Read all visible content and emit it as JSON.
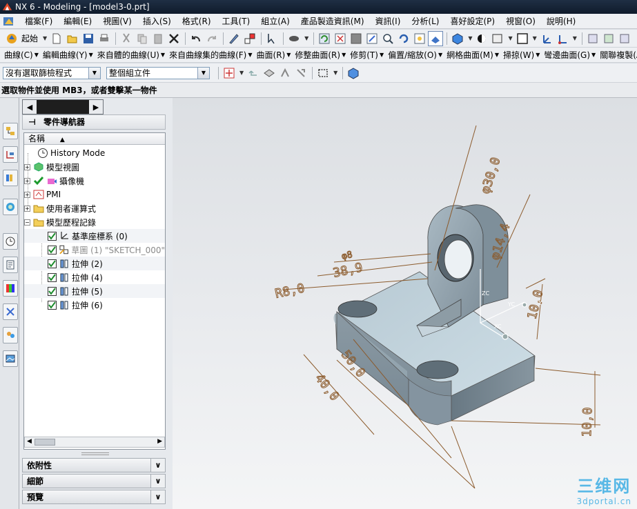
{
  "window": {
    "title": "NX 6 - Modeling - [model3-0.prt]"
  },
  "menu": [
    "檔案(F)",
    "編輯(E)",
    "視圖(V)",
    "插入(S)",
    "格式(R)",
    "工具(T)",
    "組立(A)",
    "產品製造資訊(M)",
    "資訊(I)",
    "分析(L)",
    "喜好設定(P)",
    "視窗(O)",
    "說明(H)"
  ],
  "toolbar1": {
    "start_label": "起始"
  },
  "toolbar2": {
    "items": [
      "曲線(C)",
      "編輯曲線(Y)",
      "來自體的曲線(U)",
      "來自曲線集的曲線(F)",
      "曲面(R)",
      "修整曲面(R)",
      "修剪(T)",
      "偏置/縮放(O)",
      "網格曲面(M)",
      "掃掠(W)",
      "彎邊曲面(G)",
      "關聯複製(A)"
    ]
  },
  "toolbar3": {
    "filter": "沒有選取篩檢程式",
    "scope": "整個組立件"
  },
  "status": {
    "prompt": "選取物件並使用 MB3，或者雙擊某一物件"
  },
  "navigator": {
    "title": "零件導航器",
    "column": "名稱",
    "nodes": [
      {
        "label": "History Mode"
      },
      {
        "label": "模型視圖"
      },
      {
        "label": "攝像機"
      },
      {
        "label": "PMI"
      },
      {
        "label": "使用者運算式"
      },
      {
        "label": "模型歷程記錄"
      },
      {
        "label": "基準座標系 (0)"
      },
      {
        "label": "草圖 (1) \"SKETCH_000\""
      },
      {
        "label": "拉伸 (2)"
      },
      {
        "label": "拉伸 (4)"
      },
      {
        "label": "拉伸 (5)"
      },
      {
        "label": "拉伸 (6)"
      }
    ]
  },
  "panels": [
    "依附性",
    "細節",
    "預覽"
  ],
  "dimensions": [
    "φ30,0",
    "φ14,4",
    "R8,0",
    "38,9",
    "φ8",
    "10,0",
    "40,0",
    "50,0",
    "10,0"
  ],
  "triad": [
    "ZC",
    "YC",
    "XC",
    "Y"
  ],
  "watermark": {
    "brand": "三维网",
    "url": "3dportal.cn"
  }
}
